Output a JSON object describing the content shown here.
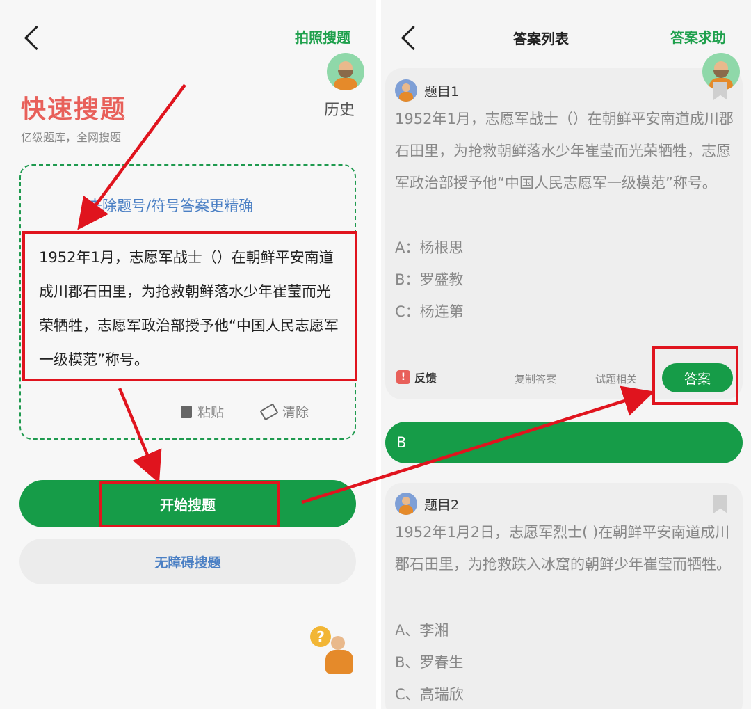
{
  "left": {
    "header": {
      "action_label": "拍照搜题"
    },
    "title": "快速搜题",
    "subtitle": "亿级题库，全网搜题",
    "history_label": "历史",
    "hint": "去除题号/符号答案更精确",
    "question_text": "1952年1月，志愿军战士（）在朝鲜平安南道成川郡石田里，为抢救朝鲜落水少年崔莹而光荣牺牲，志愿军政治部授予他“中国人民志愿军一级模范”称号。",
    "paste_label": "粘贴",
    "clear_label": "清除",
    "start_button": "开始搜题",
    "accessible_button": "无障碍搜题",
    "help_icon_glyph": "?"
  },
  "right": {
    "header": {
      "title": "答案列表",
      "action_label": "答案求助"
    },
    "q1": {
      "label": "题目1",
      "text": "1952年1月，志愿军战士（）在朝鲜平安南道成川郡石田里，为抢救朝鲜落水少年崔莹而光荣牺牲，志愿军政治部授予他“中国人民志愿军一级模范”称号。",
      "options": [
        "A：杨根思",
        "B：罗盛教",
        "C：杨连第"
      ],
      "feedback_icon": "!",
      "feedback": "反馈",
      "copy": "复制答案",
      "related": "试题相关",
      "answer_button": "答案"
    },
    "answer": "B",
    "q2": {
      "label": "题目2",
      "text": "1952年1月2日，志愿军烈士(    )在朝鲜平安南道成川郡石田里，为抢救跌入冰窟的朝鲜少年崔莹而牺牲。",
      "options": [
        "A、李湘",
        "B、罗春生",
        "C、高瑞欣"
      ]
    }
  },
  "colors": {
    "brand_green": "#169c48",
    "title_red": "#e8605a",
    "hint_blue": "#4a7fc4",
    "annotation_red": "#e0141e"
  }
}
